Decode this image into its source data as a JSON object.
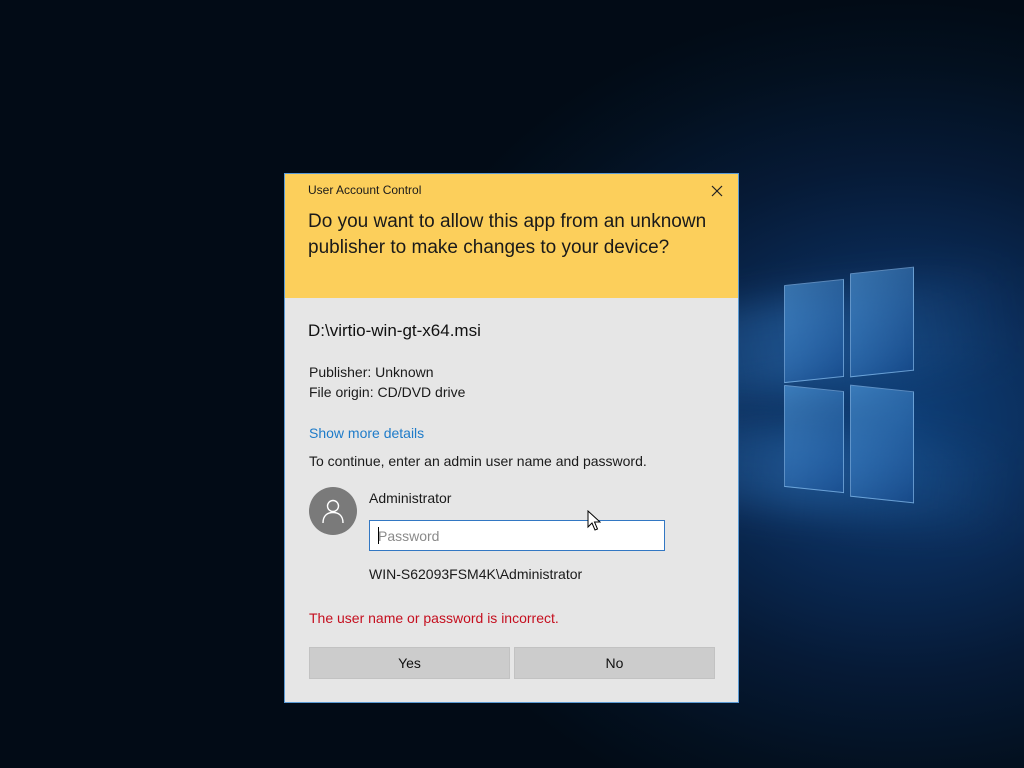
{
  "dialog": {
    "caption": "User Account Control",
    "question": "Do you want to allow this app from an unknown publisher to make changes to your device?",
    "file_name": "D:\\virtio-win-gt-x64.msi",
    "publisher": "Publisher: Unknown",
    "file_origin": "File origin: CD/DVD drive",
    "show_more": "Show more details",
    "continue_text": "To continue, enter an admin user name and password.",
    "username": "Administrator",
    "password": {
      "value": "",
      "placeholder": "Password"
    },
    "domain_user": "WIN-S62093FSM4K\\Administrator",
    "error": "The user name or password is incorrect.",
    "buttons": {
      "yes": "Yes",
      "no": "No"
    }
  },
  "icons": {
    "close": "close-icon",
    "avatar": "user-avatar-icon",
    "cursor": "mouse-pointer-icon"
  },
  "colors": {
    "header_bg": "#fccf5b",
    "dialog_bg": "#e6e6e6",
    "link": "#1e7bc9",
    "error": "#c50f1f",
    "input_border": "#3277c3",
    "button_bg": "#cccccc"
  }
}
